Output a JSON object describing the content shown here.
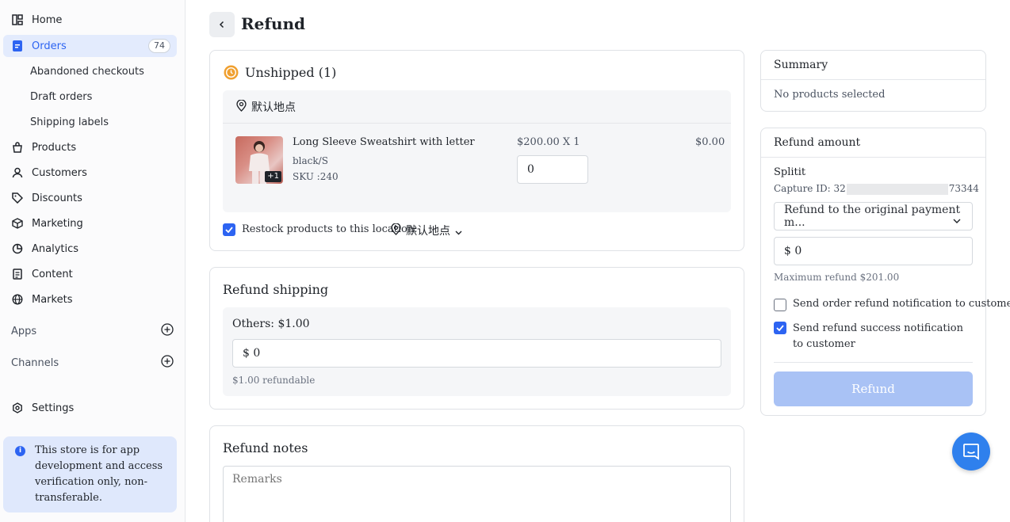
{
  "sidebar": {
    "items": [
      {
        "label": "Home",
        "icon": "home-icon"
      },
      {
        "label": "Orders",
        "icon": "orders-icon",
        "badge": "74"
      },
      {
        "label": "Abandoned checkouts"
      },
      {
        "label": "Draft orders"
      },
      {
        "label": "Shipping labels"
      },
      {
        "label": "Products",
        "icon": "bag-icon"
      },
      {
        "label": "Customers",
        "icon": "person-icon"
      },
      {
        "label": "Discounts",
        "icon": "tag-icon"
      },
      {
        "label": "Marketing",
        "icon": "cube-icon"
      },
      {
        "label": "Analytics",
        "icon": "pie-chart-icon"
      },
      {
        "label": "Content",
        "icon": "document-icon"
      },
      {
        "label": "Markets",
        "icon": "globe-icon"
      }
    ],
    "apps_label": "Apps",
    "channels_label": "Channels",
    "settings_label": "Settings",
    "notice": "This store is for app development and access verification only, non-transferable."
  },
  "header": {
    "title": "Refund"
  },
  "unshipped": {
    "title": "Unshipped (1)",
    "location": "默认地点",
    "product": {
      "name": "Long Sleeve Sweatshirt with letter",
      "variant": "black/S",
      "sku": "SKU :240",
      "price_qty": "$200.00 X 1",
      "total": "$0.00",
      "quantity": "0",
      "extra_images": "+1"
    },
    "restock_label": "Restock products to this location:",
    "restock_location": "默认地点"
  },
  "refund_shipping": {
    "title": "Refund shipping",
    "others": "Others: $1.00",
    "amount": "$ 0",
    "refundable": "$1.00 refundable"
  },
  "refund_notes": {
    "title": "Refund notes",
    "placeholder": "Remarks"
  },
  "summary": {
    "title": "Summary",
    "empty": "No products selected"
  },
  "refund_amount": {
    "title": "Refund amount",
    "provider": "Splitit",
    "capture_prefix": "Capture ID: 32",
    "capture_suffix": "73344",
    "method": "Refund to the original payment m...",
    "amount": "$ 0",
    "max": "Maximum refund $201.00",
    "notify_order": "Send order refund notification to customer",
    "notify_success": "Send refund success notification to customer",
    "button": "Refund"
  },
  "colors": {
    "accent": "#2d64f2",
    "refund_button_disabled": "#a9c2f5",
    "chat": "#2f80ed",
    "status_orange": "#f0a030"
  }
}
